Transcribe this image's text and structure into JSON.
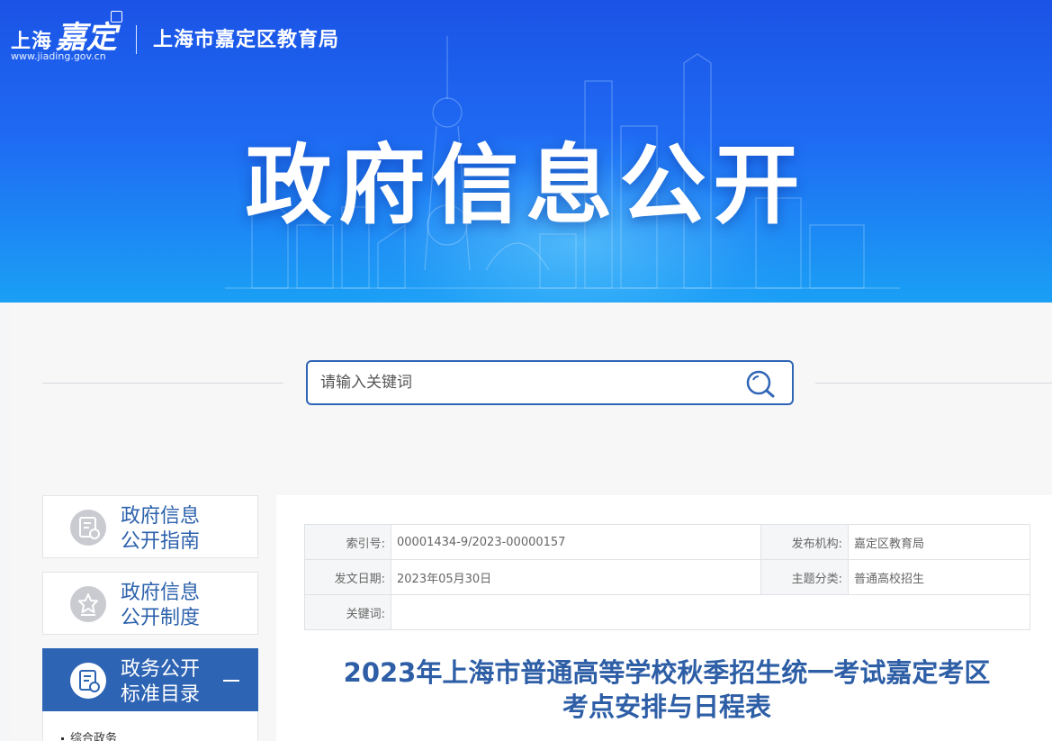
{
  "header": {
    "logo_shanghai": "上海",
    "logo_jiading": "嘉定",
    "logo_url": "www.jiading.gov.cn",
    "site_name": "上海市嘉定区教育局",
    "banner_title": "政府信息公开"
  },
  "search": {
    "placeholder": "请输入关键词",
    "icon": "search-icon"
  },
  "sidebar": {
    "items": [
      {
        "line1": "政府信息",
        "line2": "公开指南",
        "icon": "document-icon",
        "active": false
      },
      {
        "line1": "政府信息",
        "line2": "公开制度",
        "icon": "star-badge-icon",
        "active": false
      },
      {
        "line1": "政务公开",
        "line2": "标准目录",
        "icon": "document-icon",
        "active": true
      }
    ],
    "sub_items": [
      "综合政务"
    ]
  },
  "meta": {
    "index_label": "索引号:",
    "index_value": "00001434-9/2023-00000157",
    "publisher_label": "发布机构:",
    "publisher_value": "嘉定区教育局",
    "date_label": "发文日期:",
    "date_value": "2023年05月30日",
    "topic_label": "主题分类:",
    "topic_value": "普通高校招生",
    "keywords_label": "关键词:",
    "keywords_value": ""
  },
  "document": {
    "title_line1": "2023年上海市普通高等学校秋季招生统一考试嘉定考区",
    "title_line2": "考点安排与日程表"
  },
  "colors": {
    "primary": "#2e64b4",
    "banner_top": "#1b53e6",
    "banner_bottom": "#1aa0f5",
    "title_blue": "#2d5ea6"
  }
}
